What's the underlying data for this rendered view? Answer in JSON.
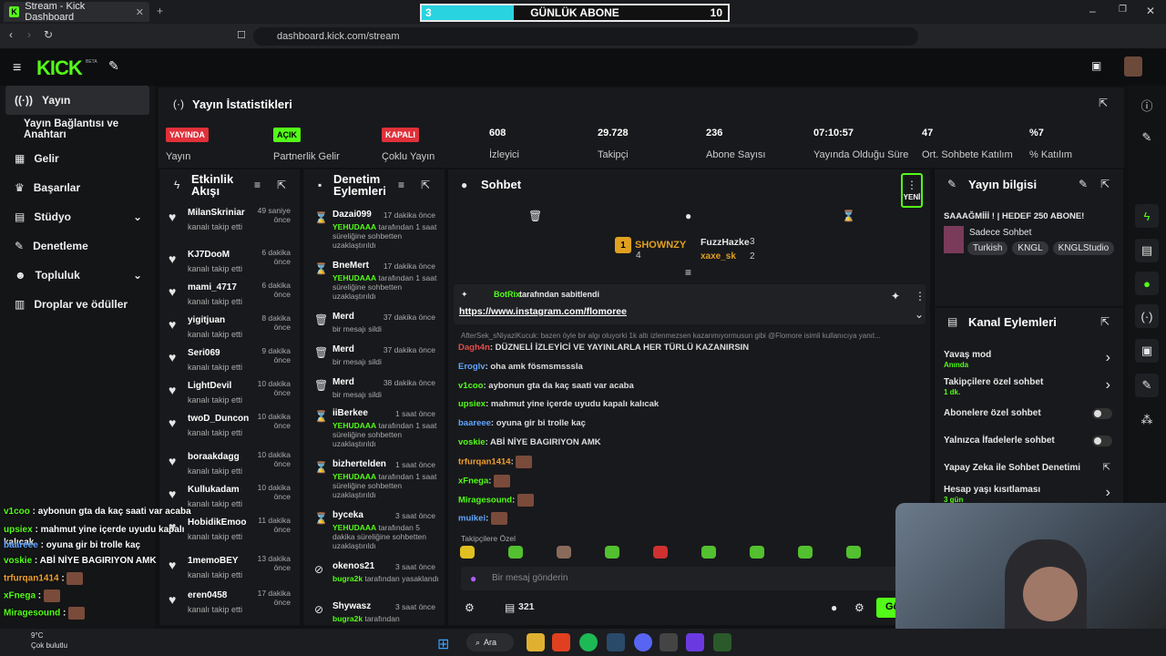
{
  "browser": {
    "tab_title": "Stream - Kick Dashboard",
    "url": "dashboard.kick.com/stream"
  },
  "overlay": {
    "left": "3",
    "title": "GÜNLÜK ABONE",
    "right": "10",
    "progress": 0.3
  },
  "app": {
    "logo": "KICK",
    "beta": "BETA"
  },
  "sidenav": {
    "items": [
      {
        "label": "Yayın",
        "selected": true
      },
      {
        "label": "Yayın Bağlantısı ve Anahtarı"
      },
      {
        "label": "Gelir"
      },
      {
        "label": "Başarılar"
      },
      {
        "label": "Stüdyo"
      },
      {
        "label": "Denetleme"
      },
      {
        "label": "Topluluk"
      },
      {
        "label": "Droplar ve ödüller"
      }
    ]
  },
  "stats": {
    "title": "Yayın İstatistikleri",
    "items": [
      {
        "badge": "YAYINDA",
        "label": "Yayın",
        "color": "#e0303a"
      },
      {
        "badge": "AÇIK",
        "label": "Partnerlik Gelir",
        "color": "#53fc18"
      },
      {
        "badge": "KAPALI",
        "label": "Çoklu Yayın",
        "color": "#e0303a"
      },
      {
        "value": "608",
        "label": "İzleyici"
      },
      {
        "value": "29.728",
        "label": "Takipçi"
      },
      {
        "value": "236",
        "label": "Abone Sayısı"
      },
      {
        "value": "07:10:57",
        "label": "Yayında Olduğu Süre"
      },
      {
        "value": "47",
        "label": "Ort. Sohbete Katılım"
      },
      {
        "value": "%7",
        "label": "% Katılım"
      }
    ]
  },
  "activity": {
    "title": "Etkinlik Akışı",
    "items": [
      {
        "name": "MilanSkriniar",
        "time": "49 saniye önce",
        "text": "kanalı takip etti"
      },
      {
        "name": "KJ7DooM",
        "time": "6 dakika önce",
        "text": "kanalı takip etti"
      },
      {
        "name": "mami_4717",
        "time": "6 dakika önce",
        "text": "kanalı takip etti"
      },
      {
        "name": "yigitjuan",
        "time": "8 dakika önce",
        "text": "kanalı takip etti"
      },
      {
        "name": "Seri069",
        "time": "9 dakika önce",
        "text": "kanalı takip etti"
      },
      {
        "name": "LightDevil",
        "time": "10 dakika önce",
        "text": "kanalı takip etti"
      },
      {
        "name": "twoD_Duncon",
        "time": "10 dakika önce",
        "text": "kanalı takip etti"
      },
      {
        "name": "boraakdagg",
        "time": "10 dakika önce",
        "text": "kanalı takip etti"
      },
      {
        "name": "Kullukadam",
        "time": "10 dakika önce",
        "text": "kanalı takip etti"
      },
      {
        "name": "HobidikEmoo",
        "time": "11 dakika önce",
        "text": "kanalı takip etti"
      },
      {
        "name": "1memoBEY",
        "time": "13 dakika önce",
        "text": "kanalı takip etti"
      },
      {
        "name": "eren0458",
        "time": "17 dakika önce",
        "text": "kanalı takip etti"
      }
    ]
  },
  "moderation": {
    "title": "Denetim Eylemleri",
    "items": [
      {
        "name": "Dazai099",
        "time": "17 dakika önce",
        "mod": "YEHUDAAA",
        "text": "tarafından 1 saat süreliğine sohbetten uzaklaştırıldı"
      },
      {
        "name": "BneMert",
        "time": "17 dakika önce",
        "mod": "YEHUDAAA",
        "text": "tarafından 1 saat süreliğine sohbetten uzaklaştırıldı"
      },
      {
        "name": "Merd",
        "time": "37 dakika önce",
        "mod": "",
        "text": "bir mesajı sildi"
      },
      {
        "name": "Merd",
        "time": "37 dakika önce",
        "mod": "",
        "text": "bir mesajı sildi"
      },
      {
        "name": "Merd",
        "time": "38 dakika önce",
        "mod": "",
        "text": "bir mesajı sildi"
      },
      {
        "name": "iiBerkee",
        "time": "1 saat önce",
        "mod": "YEHUDAAA",
        "text": "tarafından 1 saat süreliğine sohbetten uzaklaştırıldı"
      },
      {
        "name": "bizhertelden",
        "time": "1 saat önce",
        "mod": "YEHUDAAA",
        "text": "tarafından 1 saat süreliğine sohbetten uzaklaştırıldı"
      },
      {
        "name": "byceka",
        "time": "3 saat önce",
        "mod": "YEHUDAAA",
        "text": "tarafından 5 dakika süreliğine sohbetten uzaklaştırıldı"
      },
      {
        "name": "okenos21",
        "time": "3 saat önce",
        "mod": "bugra2k",
        "text": "tarafından yasaklandı"
      },
      {
        "name": "Shywasz",
        "time": "3 saat önce",
        "mod": "bugra2k",
        "text": "tarafından"
      }
    ]
  },
  "chat": {
    "title": "Sohbet",
    "new": "YENİ",
    "top": [
      {
        "rank": "1",
        "name": "SHOWNZY",
        "count": "4"
      },
      {
        "name": "FuzzHazke",
        "count": "3"
      },
      {
        "name": "xaxe_sk",
        "count": "2"
      }
    ],
    "pinned": {
      "by": "BotRix",
      "by_text": "tarafından sabitlendi",
      "link": "https://www.instagram.com/flomoree"
    },
    "reply": "AfterSek_sNiyaziKucuk: bazen öyle bir algı oluyorki 1k altı izlenmezsen kazanmıyormusun gibi @Flomore isimli kullanıcıya yanıt...",
    "messages": [
      {
        "user": "Dagh4n",
        "text": "DÜZNELİ İZLEYİCİ VE YAYINLARLA HER TÜRLÜ KAZANIRSIN",
        "color": "#e24b4b"
      },
      {
        "user": "Eroglv",
        "text": "oha amk fösmsmsssla",
        "color": "#60a5ff"
      },
      {
        "user": "v1coo",
        "text": "aybonun gta da kaç saati var acaba",
        "color": "#53fc18"
      },
      {
        "user": "upsiex",
        "text": "mahmut yine içerde uyudu kapalı kalıcak",
        "color": "#53fc18"
      },
      {
        "user": "baareee",
        "text": "oyuna gir bi trolle kaç",
        "color": "#60a5ff"
      },
      {
        "user": "voskie",
        "text": "ABİ NİYE BAGIRIYON AMK",
        "color": "#53fc18"
      },
      {
        "user": "trfurqan1414",
        "text": "",
        "color": "#f0a030"
      },
      {
        "user": "xFnega",
        "text": "",
        "color": "#53fc18"
      },
      {
        "user": "Miragesound",
        "text": "",
        "color": "#53fc18"
      },
      {
        "user": "muikei",
        "text": "",
        "color": "#60a5ff"
      }
    ],
    "followers_only": "Takipçilere Özel",
    "placeholder": "Bir mesaj gönderin",
    "viewers": "321",
    "send": "Gönder"
  },
  "info": {
    "title": "Yayın bilgisi",
    "stream_title": "SAAAĞMİİİ ! | HEDEF 250 ABONE!",
    "category": "Sadece Sohbet",
    "tags": [
      "Turkish",
      "KNGL",
      "KNGLStudio"
    ]
  },
  "actions": {
    "title": "Kanal Eylemleri",
    "items": [
      {
        "label": "Yavaş mod",
        "sub": "Anında",
        "type": "arrow"
      },
      {
        "label": "Takipçilere özel sohbet",
        "sub": "1 dk.",
        "type": "arrow"
      },
      {
        "label": "Abonelere özel sohbet",
        "sub": "",
        "type": "toggle"
      },
      {
        "label": "Yalnızca İfadelerle sohbet",
        "sub": "",
        "type": "toggle"
      },
      {
        "label": "Yapay Zeka ile Sohbet Denetimi",
        "sub": "",
        "type": "link"
      },
      {
        "label": "Hesap yaşı kısıtlaması",
        "sub": "3 gün",
        "type": "arrow"
      }
    ]
  },
  "overlay_chat": [
    {
      "user": "v1coo",
      "text": "aybonun gta da kaç saati var acaba",
      "color": "#53fc18"
    },
    {
      "user": "upsiex",
      "text": "mahmut yine içerde uyudu kapalı kalıcak",
      "color": "#53fc18"
    },
    {
      "user": "baareee",
      "text": "oyuna gir bi trolle kaç",
      "color": "#60a5ff"
    },
    {
      "user": "voskie",
      "text": "ABİ NİYE BAGIRIYON AMK",
      "color": "#53fc18"
    },
    {
      "user": "trfurqan1414",
      "text": "",
      "color": "#f0a030"
    },
    {
      "user": "xFnega",
      "text": "",
      "color": "#53fc18"
    },
    {
      "user": "Miragesound",
      "text": "",
      "color": "#53fc18"
    }
  ],
  "taskbar": {
    "search": "Ara",
    "weather": "9°C",
    "weather_desc": "Çok bulutlu"
  }
}
